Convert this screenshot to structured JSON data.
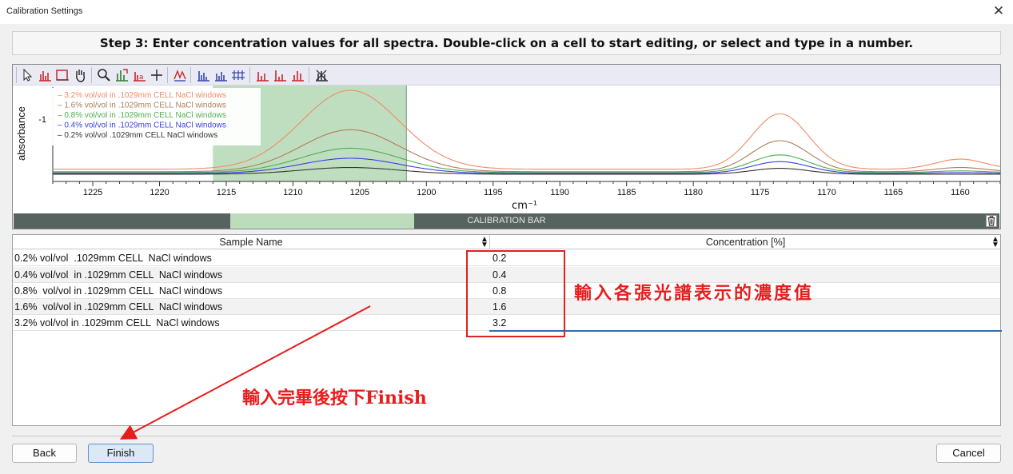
{
  "window": {
    "title": "Calibration Settings"
  },
  "step_instruction": "Step 3: Enter concentration values for all spectra.  Double-click on a cell to start editing, or select and type in a number.",
  "toolbar": {
    "icons": [
      "pointer",
      "peak-pick",
      "region",
      "pan-hand",
      "zoom",
      "fit-view",
      "scale-y",
      "crosshair",
      "overlay",
      "stack",
      "offset",
      "peak-a",
      "peak-b",
      "peak-c",
      "clear"
    ]
  },
  "calibration_bar": {
    "label": "CALIBRATION BAR"
  },
  "chart_data": {
    "type": "line",
    "xlabel": "cm⁻¹",
    "ylabel": "absorbance",
    "x_ticks": [
      "1225",
      "1220",
      "1215",
      "1210",
      "1205",
      "1200",
      "1195",
      "1190",
      "1185",
      "1180",
      "1175",
      "1170",
      "1165",
      "1160"
    ],
    "y_ticks": [
      "-1"
    ],
    "xlim": [
      1228,
      1157
    ],
    "legend_position": "top-left",
    "selected_region": [
      1216,
      1201.5
    ],
    "series": [
      {
        "name": "3.2% vol/vol in .1029mm CELL  NaCl windows",
        "color": "#f28a6a",
        "peaks": [
          {
            "x": 1205.7,
            "y": 0.94
          },
          {
            "x": 1173.5,
            "y": 0.66
          },
          {
            "x": 1160,
            "y": 0.12
          }
        ],
        "baseline": 0.07
      },
      {
        "name": "1.6%  vol/vol in .1029mm CELL  NaCl windows",
        "color": "#b07d5a",
        "peaks": [
          {
            "x": 1205.7,
            "y": 0.5
          },
          {
            "x": 1173.5,
            "y": 0.37
          },
          {
            "x": 1160,
            "y": 0.05
          }
        ],
        "baseline": 0.04
      },
      {
        "name": "0.8%  vol/vol in .1029mm CELL  NaCl windows",
        "color": "#4caf50",
        "peaks": [
          {
            "x": 1205.7,
            "y": 0.29
          },
          {
            "x": 1173.5,
            "y": 0.21
          },
          {
            "x": 1160,
            "y": 0.02
          }
        ],
        "baseline": 0.03
      },
      {
        "name": "0.4%  vol/vol  in .1029mm CELL  NaCl windows",
        "color": "#3a3ee0",
        "peaks": [
          {
            "x": 1205.7,
            "y": 0.18
          },
          {
            "x": 1173.5,
            "y": 0.14
          },
          {
            "x": 1160,
            "y": 0.01
          }
        ],
        "baseline": 0.02
      },
      {
        "name": "0.2% vol/vol  .1029mm CELL  NaCl windows",
        "color": "#333333",
        "peaks": [
          {
            "x": 1205.7,
            "y": 0.08
          },
          {
            "x": 1173.5,
            "y": 0.07
          },
          {
            "x": 1160,
            "y": 0.0
          }
        ],
        "baseline": 0.01
      }
    ]
  },
  "table": {
    "headers": [
      "Sample Name",
      "Concentration [%]"
    ],
    "rows": [
      {
        "name": "0.2% vol/vol  .1029mm CELL  NaCl windows",
        "value": "0.2"
      },
      {
        "name": "0.4% vol/vol  in .1029mm CELL  NaCl windows",
        "value": "0.4"
      },
      {
        "name": "0.8%  vol/vol in .1029mm CELL  NaCl windows",
        "value": "0.8"
      },
      {
        "name": "1.6%  vol/vol in .1029mm CELL  NaCl windows",
        "value": "1.6"
      },
      {
        "name": "3.2% vol/vol in .1029mm CELL  NaCl windows",
        "value": "3.2"
      }
    ]
  },
  "annotations": {
    "enter_values": "輸入各張光譜表示的濃度值",
    "press_finish": "輸入完畢後按下Finish"
  },
  "buttons": {
    "back": "Back",
    "finish": "Finish",
    "cancel": "Cancel"
  }
}
